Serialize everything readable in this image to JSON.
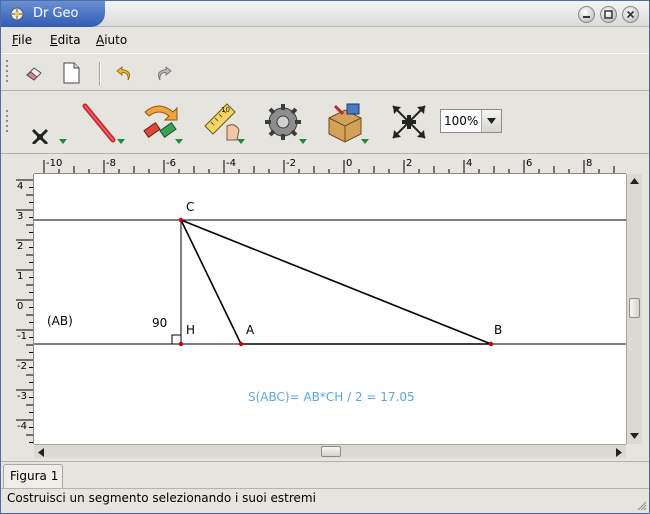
{
  "window": {
    "title": "Dr Geo",
    "accent": "#2f5cb5",
    "buttons": [
      "minimize-icon",
      "maximize-icon",
      "close-icon"
    ]
  },
  "menubar": {
    "items": [
      {
        "label": "File",
        "mnemonic": "F"
      },
      {
        "label": "Edita",
        "mnemonic": "E"
      },
      {
        "label": "Aiuto",
        "mnemonic": "A"
      }
    ]
  },
  "toolbar": {
    "buttons": [
      "eraser-icon",
      "new-document-icon",
      "undo-icon",
      "redo-icon"
    ]
  },
  "tools": {
    "items": [
      "point-tool-icon",
      "line-tool-icon",
      "transformation-tool-icon",
      "measure-tool-icon",
      "macro-tool-icon",
      "misc-tool-icon",
      "move-tool-icon"
    ],
    "zoom_value": "100%"
  },
  "rulers": {
    "horizontal_labels": [
      "-10",
      "-8",
      "-6",
      "-4",
      "-2",
      "0",
      "2",
      "4",
      "6",
      "8"
    ],
    "vertical_labels": [
      "4",
      "3",
      "2",
      "1",
      "0",
      "-1",
      "-2",
      "-3",
      "-4"
    ]
  },
  "figure": {
    "line_label": "(AB)",
    "angle_label": "90",
    "point_c": "C",
    "point_h": "H",
    "point_a": "A",
    "point_b": "B",
    "area_text": "S(ABC)= AB*CH / 2 = 17.05",
    "area_color": "#5aa7e6",
    "point_color": "#cc0000"
  },
  "tabs": {
    "active": "Figura 1"
  },
  "status": {
    "text": "Costruisci un segmento selezionando i suoi estremi"
  }
}
